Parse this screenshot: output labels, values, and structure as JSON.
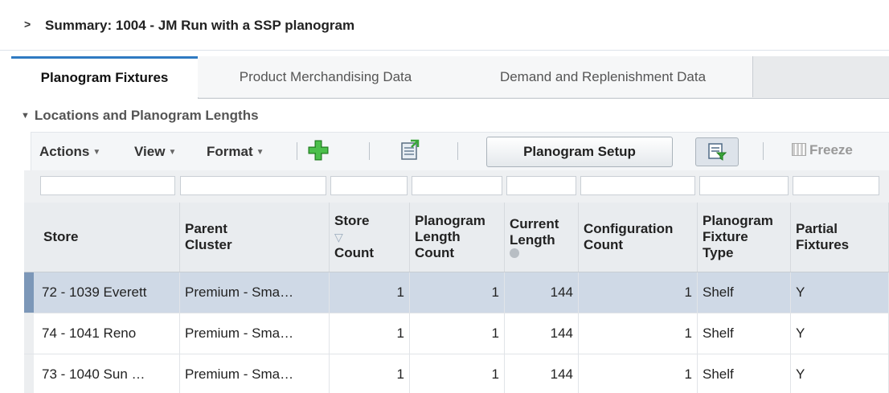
{
  "summary": {
    "chevron": ">",
    "title": "Summary: 1004 - JM Run with a SSP planogram"
  },
  "tabs": [
    {
      "label": "Planogram Fixtures",
      "active": true
    },
    {
      "label": "Product Merchandising Data",
      "active": false
    },
    {
      "label": "Demand and Replenishment Data",
      "active": false
    }
  ],
  "section": {
    "title": "Locations and Planogram Lengths"
  },
  "toolbar": {
    "actions_label": "Actions",
    "view_label": "View",
    "format_label": "Format",
    "add_icon": "add-icon",
    "export_icon": "export-icon",
    "planogram_setup_label": "Planogram Setup",
    "query_icon": "query-by-example-icon",
    "freeze_label": "Freeze"
  },
  "table": {
    "columns": [
      {
        "lines": [
          "Store"
        ]
      },
      {
        "lines": [
          "Parent",
          "Cluster"
        ]
      },
      {
        "lines": [
          "Store",
          "Count"
        ]
      },
      {
        "lines": [
          "Planogram",
          "Length",
          "Count"
        ]
      },
      {
        "lines": [
          "Current",
          "Length"
        ]
      },
      {
        "lines": [
          "Configuration",
          "Count"
        ]
      },
      {
        "lines": [
          "Planogram",
          "Fixture",
          "Type"
        ]
      },
      {
        "lines": [
          "Partial",
          "Fixtures"
        ]
      }
    ],
    "rows": [
      {
        "selected": true,
        "cells": [
          "72 - 1039 Everett",
          "Premium - Sma…",
          "1",
          "1",
          "144",
          "1",
          "Shelf",
          "Y"
        ]
      },
      {
        "selected": false,
        "cells": [
          "74 - 1041 Reno",
          "Premium - Sma…",
          "1",
          "1",
          "144",
          "1",
          "Shelf",
          "Y"
        ]
      },
      {
        "selected": false,
        "cells": [
          "73 - 1040 Sun …",
          "Premium - Sma…",
          "1",
          "1",
          "144",
          "1",
          "Shelf",
          "Y"
        ]
      }
    ]
  },
  "colors": {
    "active_tab_accent": "#2f7ac2",
    "selected_row": "#cfd9e6",
    "add_icon_green": "#3aa53a"
  }
}
